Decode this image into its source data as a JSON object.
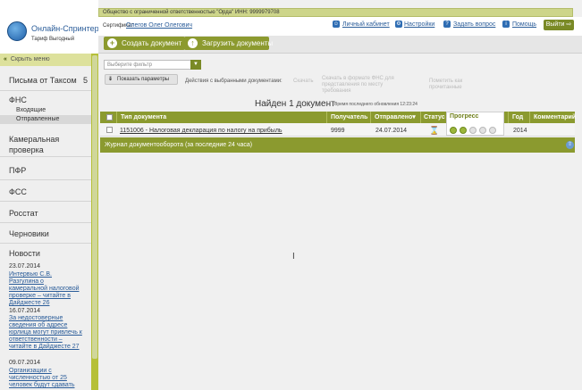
{
  "org": {
    "name": "Общество с ограниченной ответственностью \"Орда\" ИНН: 9999979708",
    "cert_label": "Сертификат:",
    "cert_name": "Олегов Олег Олегович"
  },
  "brand": {
    "title": "Онлайн-Спринтер",
    "tariff": "Тариф Выгодный"
  },
  "top_links": {
    "cabinet": "Личный кабинет",
    "settings": "Настройки",
    "ask": "Задать вопрос",
    "help": "Помощь",
    "exit": "Выйти"
  },
  "toolbar": {
    "create": "Создать документ",
    "upload": "Загрузить документы"
  },
  "sidebar": {
    "hide_label": "Скрыть меню",
    "items": [
      {
        "label": "Письма от Таксом",
        "count": "5"
      },
      {
        "label": "ФНС"
      },
      {
        "label": "Камеральная проверка"
      },
      {
        "label": "ПФР"
      },
      {
        "label": "ФСС"
      },
      {
        "label": "Росстат"
      },
      {
        "label": "Черновики"
      },
      {
        "label": "Новости"
      }
    ],
    "fns_sub": [
      "Входящие",
      "Отправленные"
    ],
    "news": [
      {
        "date": "23.07.2014",
        "text": "Интервью С.В. Разгулина о камеральной налоговой проверке – читайте в Дайджесте 26"
      },
      {
        "date": "16.07.2014",
        "text": "За недостоверные сведения об адресе юрлица могут привлечь к ответственности – читайте в Дайджесте 27"
      },
      {
        "date": "09.07.2014",
        "text": "Организации с численностью от 25 человек будут сдавать"
      }
    ]
  },
  "filter": {
    "placeholder": "Выберите фильтр"
  },
  "params": {
    "show_label": "Показать параметры",
    "actions_label": "Действия с выбранными документами:",
    "act_download": "Скачать",
    "act_fns": "Скачать в формате ФНС для представления по месту требования",
    "act_mark": "Пометить как прочитанные"
  },
  "results": {
    "found": "Найден 1 документ",
    "updated": "Время последнего обновления 12:23:24"
  },
  "table": {
    "headers": {
      "type": "Тип документа",
      "recipient": "Получатель",
      "sent": "Отправлено",
      "status": "Статус",
      "progress": "Прогресс",
      "year": "Год",
      "comment": "Комментарий"
    },
    "rows": [
      {
        "type": "1151006 - Налоговая декларация по налогу на прибыль",
        "recipient": "9999",
        "sent": "24.07.2014",
        "status_icon": "hourglass-icon",
        "progress_done": 2,
        "progress_total": 5,
        "year": "2014",
        "comment": ""
      }
    ]
  },
  "journal": {
    "title": "Журнал документооборота (за последние 24 часа)"
  },
  "colors": {
    "accent": "#8b9a2f",
    "link": "#2a5c99",
    "strip": "#cdd58a"
  }
}
